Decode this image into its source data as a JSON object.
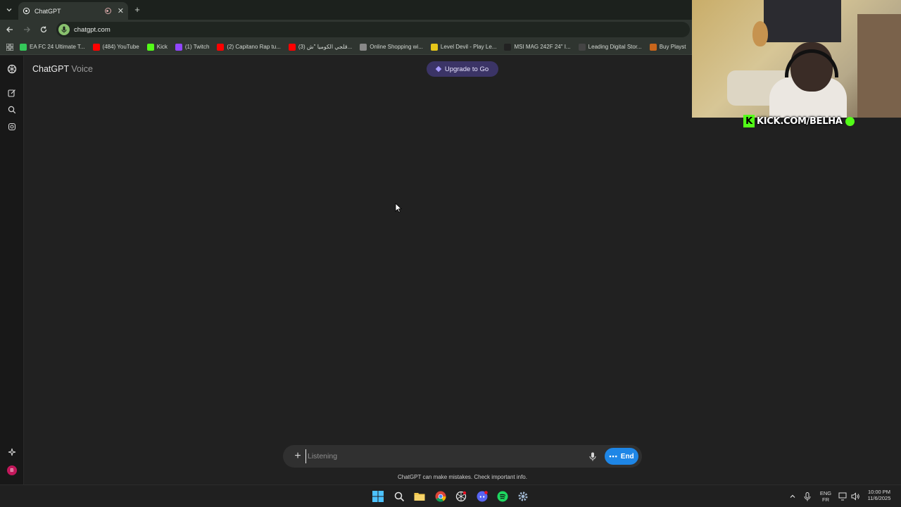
{
  "browser": {
    "tab": {
      "title": "ChatGPT"
    },
    "url": "chatgpt.com",
    "bookmarks": [
      {
        "label": "EA FC 24 Ultimate T...",
        "icon": "ea-icon",
        "color": "#34c759"
      },
      {
        "label": "(484) YouTube",
        "icon": "youtube-icon",
        "color": "#ff0000"
      },
      {
        "label": "Kick",
        "icon": "kick-icon",
        "color": "#53fc18"
      },
      {
        "label": "(1) Twitch",
        "icon": "twitch-icon",
        "color": "#9146ff"
      },
      {
        "label": "(2) Capitano Rap tu...",
        "icon": "youtube-icon",
        "color": "#ff0000"
      },
      {
        "label": "(3) قلجي الكوميا \"ش...",
        "icon": "youtube-icon",
        "color": "#ff0000"
      },
      {
        "label": "Online Shopping wi...",
        "icon": "globe-icon",
        "color": "#888888"
      },
      {
        "label": "Level Devil - Play Le...",
        "icon": "level-devil-icon",
        "color": "#e6c619"
      },
      {
        "label": "MSI MAG 242F 24\" I...",
        "icon": "msi-icon",
        "color": "#222222"
      },
      {
        "label": "Leading Digital Stor...",
        "icon": "store-icon",
        "color": "#444444"
      },
      {
        "label": "Buy Playst",
        "icon": "shopping-bag-icon",
        "color": "#c8651b"
      }
    ]
  },
  "app": {
    "title": "ChatGPT",
    "subtitle": "Voice",
    "upgrade_label": "Upgrade to Go",
    "composer": {
      "placeholder": "Listening",
      "end_label": "End"
    },
    "disclaimer": "ChatGPT can make mistakes. Check important info.",
    "avatar_letter": "B"
  },
  "taskbar": {
    "lang": "ENG",
    "layout": "FR",
    "time": "10:00 PM",
    "date": "11/6/2025"
  },
  "overlay": {
    "kick_text": "KICK.COM/BELHA"
  }
}
